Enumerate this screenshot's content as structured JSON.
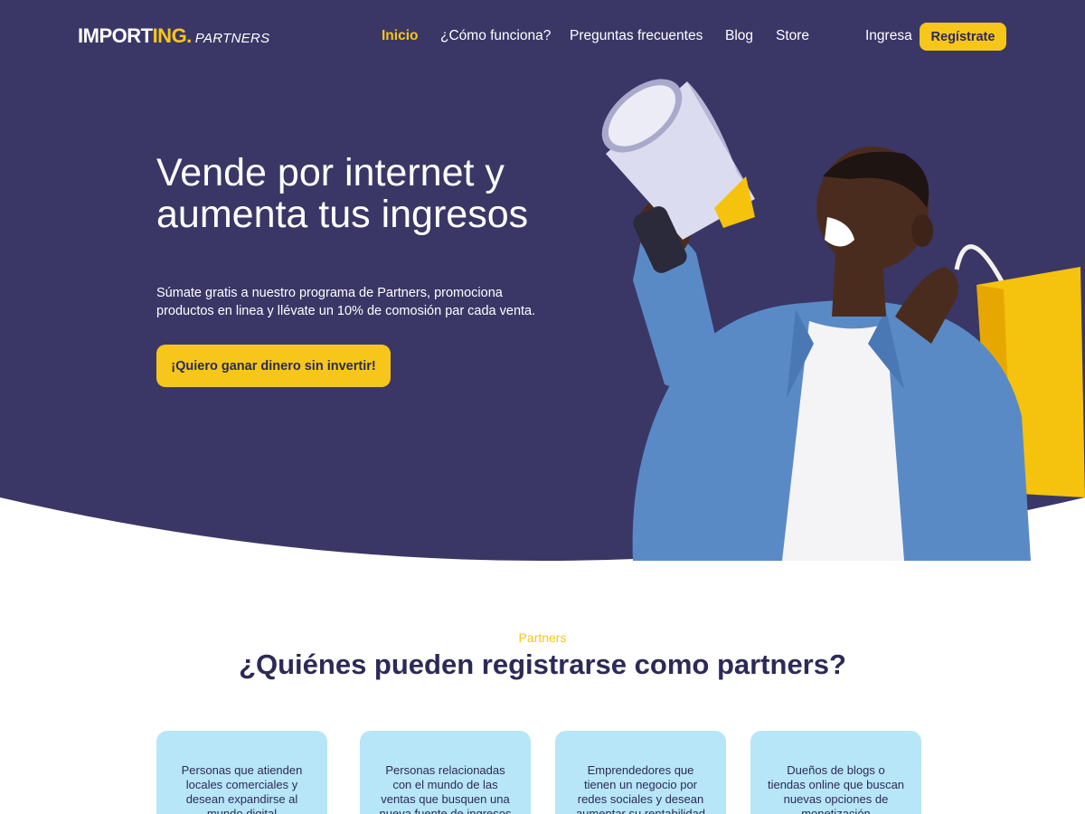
{
  "colors": {
    "hero_bg": "#3a3767",
    "accent": "#f7c61a",
    "dark_text": "#2c2a56",
    "card_bg": "#b7e6f8",
    "white": "#ffffff"
  },
  "logo": {
    "main": "IMPORT",
    "accent": "ING.",
    "sub": "PARTNERS"
  },
  "nav": {
    "items": [
      {
        "label": "Inicio",
        "active": true
      },
      {
        "label": "¿Cómo funciona?",
        "active": false
      },
      {
        "label": "Preguntas frecuentes",
        "active": false
      },
      {
        "label": "Blog",
        "active": false
      },
      {
        "label": "Store",
        "active": false
      }
    ],
    "login": "Ingresa",
    "register": "Regístrate"
  },
  "hero": {
    "title_line1": "Vende por internet y",
    "title_line2": "aumenta tus ingresos",
    "desc_line1": "Súmate gratis a nuestro programa de Partners, promociona",
    "desc_line2": "productos en linea y llévate un 10% de comosión par cada venta.",
    "cta": "¡Quiero ganar dinero sin invertir!",
    "image": "man-with-megaphone-and-shopping-bag"
  },
  "section": {
    "eyebrow": "Partners",
    "title": "¿Quiénes pueden registrarse como partners?",
    "cards": [
      {
        "text": "Personas que atienden locales comerciales y desean expandirse al mundo digital"
      },
      {
        "text": "Personas relacionadas con el mundo de las ventas que busquen una nueva fuente de ingresos"
      },
      {
        "text": "Emprendedores que tienen un negocio por redes sociales y desean aumentar su rentabilidad"
      },
      {
        "text": "Dueños de blogs o tiendas online que buscan nuevas opciones de monetización"
      }
    ]
  }
}
